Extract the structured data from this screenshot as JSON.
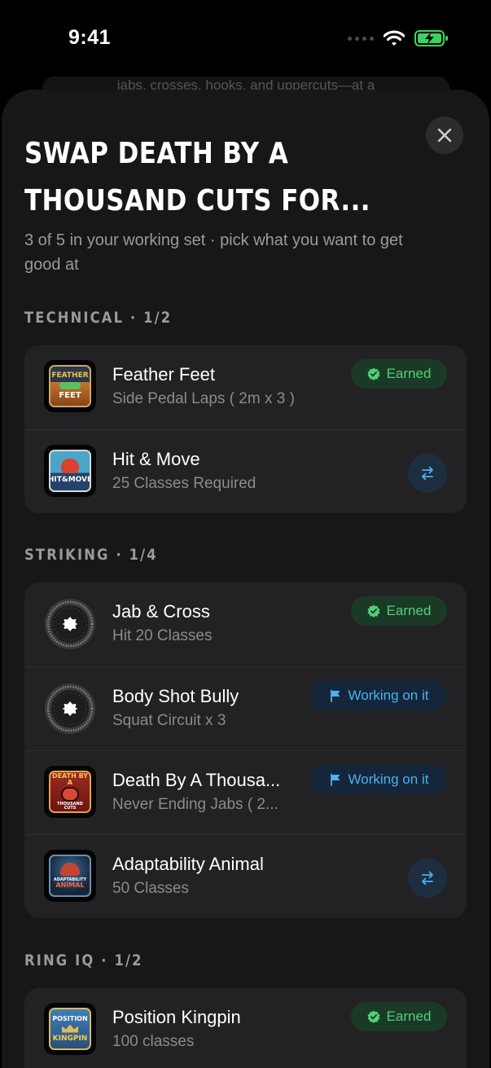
{
  "status_bar": {
    "time": "9:41"
  },
  "background": {
    "peek_text": "jabs, crosses, hooks, and uppercuts—at a"
  },
  "sheet": {
    "title": "Swap Death By A Thousand Cuts for...",
    "subtitle": "3 of 5 in your working set · pick what you want to get good at"
  },
  "sections": [
    {
      "label": "TECHNICAL · 1/2",
      "items": [
        {
          "name": "Feather Feet",
          "requirement": "Side Pedal Laps ( 2m x 3 )",
          "status": "Earned",
          "badge_lines": [
            "FEATHER",
            "FEET"
          ]
        },
        {
          "name": "Hit & Move",
          "requirement": "25 Classes Required",
          "badge_lines": [
            "HIT&MOVE"
          ]
        }
      ]
    },
    {
      "label": "STRIKING · 1/4",
      "items": [
        {
          "name": "Jab & Cross",
          "requirement": "Hit 20 Classes",
          "status": "Earned"
        },
        {
          "name": "Body Shot Bully",
          "requirement": "Squat Circuit x 3",
          "status": "Working on it"
        },
        {
          "name": "Death By A Thousa...",
          "requirement": "Never Ending Jabs ( 2...",
          "status": "Working on it",
          "badge_lines": [
            "DEATH BY A",
            "THOUSAND CUTS"
          ]
        },
        {
          "name": "Adaptability Animal",
          "requirement": "50 Classes",
          "badge_lines": [
            "ADAPTABILITY",
            "ANIMAL"
          ]
        }
      ]
    },
    {
      "label": "RING IQ · 1/2",
      "items": [
        {
          "name": "Position Kingpin",
          "requirement": "100 classes",
          "status": "Earned",
          "badge_lines": [
            "POSITION",
            "KINGPIN"
          ]
        }
      ]
    }
  ],
  "colors": {
    "sheet_bg": "#171717",
    "card_bg": "#222224",
    "earned_green": "#4fd07a",
    "working_blue": "#4ab2f0"
  }
}
